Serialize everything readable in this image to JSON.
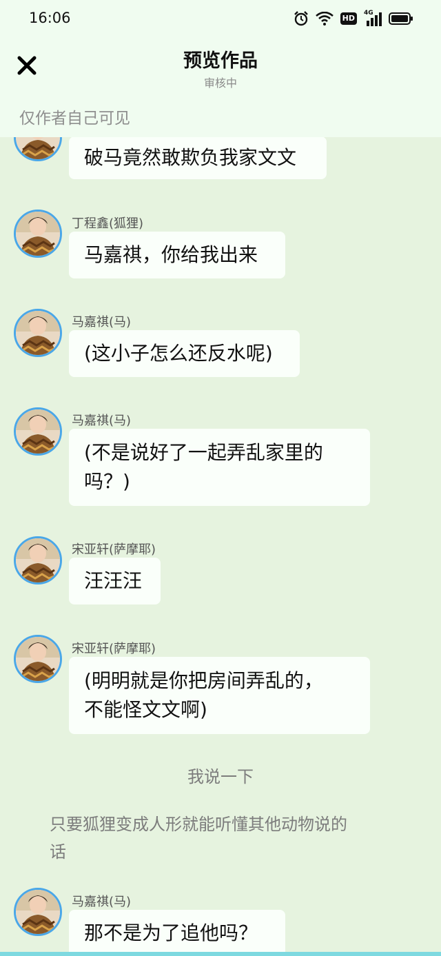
{
  "status_bar": {
    "time": "16:06",
    "icons": [
      "alarm-icon",
      "wifi-icon",
      "hd-icon",
      "signal-4g-icon",
      "battery-icon"
    ],
    "hd_label": "HD",
    "network_label": "4G"
  },
  "header": {
    "close_icon": "close-icon",
    "title": "预览作品",
    "subtitle": "审核中",
    "visibility_note": "仅作者自己可见"
  },
  "messages": [
    {
      "type": "chat",
      "speaker": "",
      "text": "破马竟然敢欺负我家文文",
      "avatar": "avatar-icon"
    },
    {
      "type": "chat",
      "speaker": "丁程鑫(狐狸)",
      "text": "马嘉祺，你给我出来",
      "avatar": "avatar-icon"
    },
    {
      "type": "chat",
      "speaker": "马嘉祺(马)",
      "text": "(这小子怎么还反水呢)",
      "avatar": "avatar-icon"
    },
    {
      "type": "chat",
      "speaker": "马嘉祺(马)",
      "text_line1": "(不是说好了一起弄乱家里的",
      "text_line2": "吗？)",
      "avatar": "avatar-icon"
    },
    {
      "type": "chat",
      "speaker": "宋亚轩(萨摩耶)",
      "text": "汪汪汪",
      "avatar": "avatar-icon"
    },
    {
      "type": "chat",
      "speaker": "宋亚轩(萨摩耶)",
      "text_line1": "(明明就是你把房间弄乱的，",
      "text_line2": "不能怪文文啊)",
      "avatar": "avatar-icon"
    },
    {
      "type": "narration",
      "text": "我说一下"
    },
    {
      "type": "narration",
      "text_line1": "只要狐狸变成人形就能听懂其他动物说的",
      "text_line2": "话"
    },
    {
      "type": "chat",
      "speaker": "马嘉祺(马)",
      "text": "那不是为了追他吗？",
      "avatar": "avatar-icon"
    }
  ],
  "colors": {
    "background": "#e6f3df",
    "header_bg": "#f0fcf0",
    "bubble_bg": "#fafffa",
    "avatar_ring": "#4aa7e8",
    "bottom_bar": "#7ed9e0"
  }
}
